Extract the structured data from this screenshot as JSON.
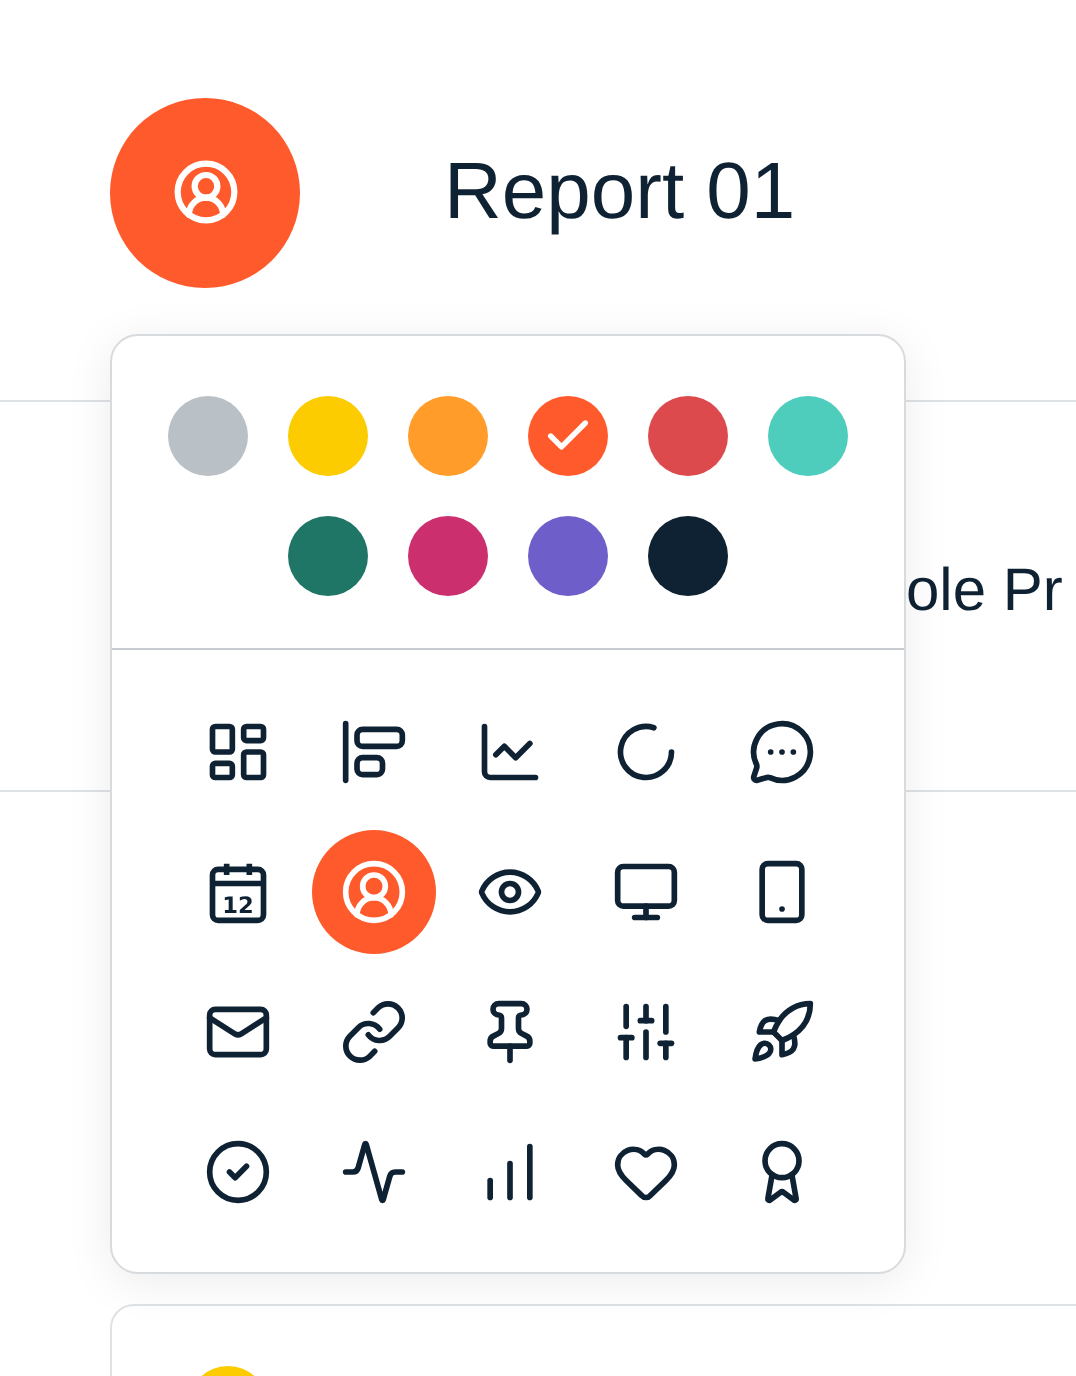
{
  "header": {
    "title": "Report 01"
  },
  "background": {
    "partial_title": "ole Pr"
  },
  "colors": [
    {
      "color": "#b9c0c6",
      "selected": false
    },
    {
      "color": "#fccb00",
      "selected": false
    },
    {
      "color": "#ff9c2a",
      "selected": false
    },
    {
      "color": "#ff5a2c",
      "selected": true
    },
    {
      "color": "#dc4a4e",
      "selected": false
    },
    {
      "color": "#4ecdbd",
      "selected": false
    },
    {
      "color": "#1f7566",
      "selected": false
    },
    {
      "color": "#cc2f6e",
      "selected": false
    },
    {
      "color": "#6d5ec9",
      "selected": false
    },
    {
      "color": "#0f2233",
      "selected": false
    }
  ],
  "calendar_day": "12",
  "icons": [
    {
      "kind": "dashboard",
      "selected": false
    },
    {
      "kind": "bars",
      "selected": false
    },
    {
      "kind": "line",
      "selected": false
    },
    {
      "kind": "ring",
      "selected": false
    },
    {
      "kind": "message",
      "selected": false
    },
    {
      "kind": "calendar",
      "selected": false
    },
    {
      "kind": "user",
      "selected": true
    },
    {
      "kind": "eye",
      "selected": false
    },
    {
      "kind": "monitor",
      "selected": false
    },
    {
      "kind": "phone",
      "selected": false
    },
    {
      "kind": "mail",
      "selected": false
    },
    {
      "kind": "link",
      "selected": false
    },
    {
      "kind": "pin",
      "selected": false
    },
    {
      "kind": "sliders",
      "selected": false
    },
    {
      "kind": "rocket",
      "selected": false
    },
    {
      "kind": "check",
      "selected": false
    },
    {
      "kind": "activity",
      "selected": false
    },
    {
      "kind": "chart",
      "selected": false
    },
    {
      "kind": "heart",
      "selected": false
    },
    {
      "kind": "award",
      "selected": false
    }
  ]
}
